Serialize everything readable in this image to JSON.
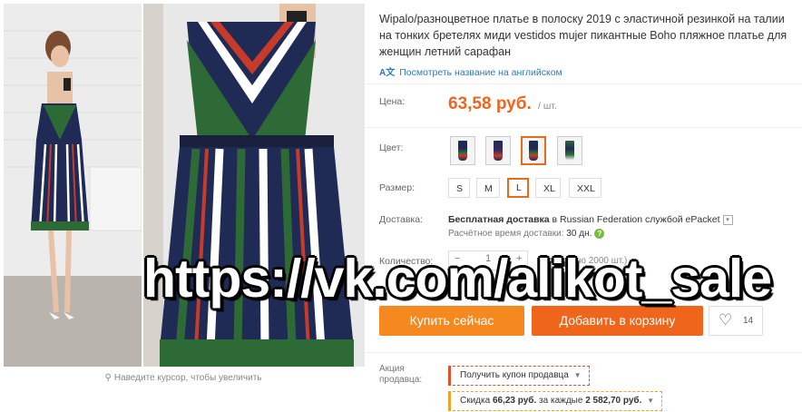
{
  "product": {
    "title": "Wipalo/разноцветное платье в полоску 2019 с эластичной резинкой на талии на тонких бретелях миди vestidos mujer пикантные Boho пляжное платье для женщин летний сарафан",
    "translate_link": "Посмотреть название на английском",
    "translate_icon": "translate-icon"
  },
  "gallery": {
    "zoom_hint": "Наведите курсор, чтобы увеличить",
    "zoom_icon": "magnifier-icon"
  },
  "price": {
    "label": "Цена:",
    "value": "63,58 руб.",
    "unit": "/ шт.",
    "color": "#f0641e"
  },
  "color": {
    "label": "Цвет:",
    "selected_index": 2
  },
  "size": {
    "label": "Размер:",
    "options": [
      "S",
      "M",
      "L",
      "XL",
      "XXL"
    ],
    "selected": "L"
  },
  "shipping": {
    "label": "Доставка:",
    "free": "Бесплатная доставка",
    "in": "в",
    "country": "Russian Federation",
    "service": "службой ePacket",
    "time_label": "Расчётное время доставки:",
    "time_value": "30 дн."
  },
  "quantity": {
    "label": "Количество:",
    "value": "1",
    "minus": "−",
    "plus": "+",
    "available": "(доступно 2000 шт.)"
  },
  "actions": {
    "buy_now": "Купить сейчас",
    "add_to_cart": "Добавить в корзину",
    "wishlist_count": "14",
    "buy_color": "#f5891f",
    "cart_color": "#f0651c"
  },
  "promo": {
    "label": "Акция продавца:",
    "coupon": "Получить купон продавца",
    "discount_prefix": "Скидка",
    "discount_amount": "66,23 руб.",
    "discount_mid": "за каждые",
    "discount_threshold": "2 582,70 руб."
  },
  "watermark": "https://vk.com/alikot_sale"
}
